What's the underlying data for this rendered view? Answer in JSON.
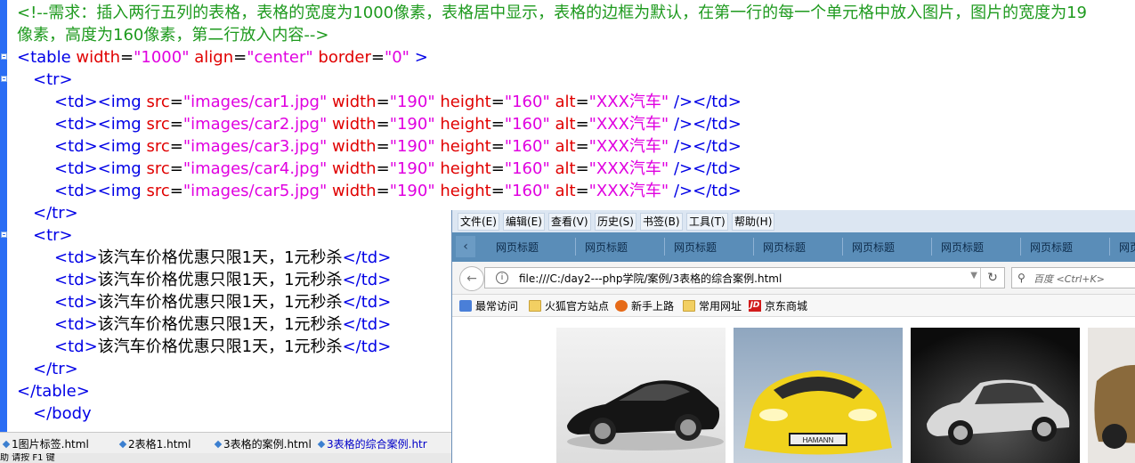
{
  "editor": {
    "comment_line1": "<!--需求：插入两行五列的表格，表格的宽度为1000像素，表格居中显示，表格的边框为默认，在第一行的每一个单元格中放入图片，图片的宽度为19",
    "comment_line2": "像素，高度为160像素，第二行放入内容-->",
    "table_open": {
      "tag": "<table",
      "attr1": "width",
      "val1": "\"1000\"",
      "attr2": "align",
      "val2": "\"center\"",
      "attr3": "border",
      "val3": "\"0\"",
      "close": ">"
    },
    "tr_open": "<tr>",
    "tr_close": "</tr>",
    "table_close": "</table>",
    "img_rows": [
      {
        "src": "\"images/car1.jpg\""
      },
      {
        "src": "\"images/car2.jpg\""
      },
      {
        "src": "\"images/car3.jpg\""
      },
      {
        "src": "\"images/car4.jpg\""
      },
      {
        "src": "\"images/car5.jpg\""
      }
    ],
    "img_parts": {
      "td_open": "<td>",
      "img_tag": "<img",
      "src_attr": "src",
      "width_attr": "width",
      "width_val": "\"190\"",
      "height_attr": "height",
      "height_val": "\"160\"",
      "alt_attr": "alt",
      "alt_val": "\"XXX汽车\"",
      "self_close": "/>",
      "td_close": "</td>"
    },
    "text_cell": "该汽车价格优惠只限1天，1元秒杀",
    "text_row_count": 5,
    "partial_line": "</body"
  },
  "editor_tabs": [
    {
      "label": "1图片标签.html",
      "active": false
    },
    {
      "label": "2表格1.html",
      "active": false
    },
    {
      "label": "3表格的案例.html",
      "active": false
    },
    {
      "label": "3表格的综合案例.htr",
      "active": true
    }
  ],
  "statusbar": {
    "text": "助  请按 F1 键"
  },
  "browser": {
    "menu": [
      "文件(E)",
      "编辑(E)",
      "查看(V)",
      "历史(S)",
      "书签(B)",
      "工具(T)",
      "帮助(H)"
    ],
    "tabs": [
      "网页标题",
      "网页标题",
      "网页标题",
      "网页标题",
      "网页标题",
      "网页标题",
      "网页标题",
      "网页"
    ],
    "url": "file:///C:/day2---php学院/案例/3表格的综合案例.html",
    "search_placeholder": "百度 <Ctrl+K>",
    "bookmarks": [
      {
        "label": "最常访问",
        "icon": "globe-icon"
      },
      {
        "label": "火狐官方站点",
        "icon": "folder-icon"
      },
      {
        "label": "新手上路",
        "icon": "firefox-icon"
      },
      {
        "label": "常用网址",
        "icon": "folder-icon"
      },
      {
        "label": "京东商城",
        "icon": "jd-icon"
      }
    ],
    "jd_badge": "JD",
    "car_badge": "HAMANN",
    "cars": [
      "car1",
      "car2",
      "car3",
      "car4"
    ]
  },
  "colors": {
    "comment": "#1e9a1e",
    "tag": "#0000e6",
    "attribute": "#e00000",
    "value": "#e000e0",
    "gutter": "#2a6df4",
    "browser_tabstrip": "#5a8db8"
  }
}
